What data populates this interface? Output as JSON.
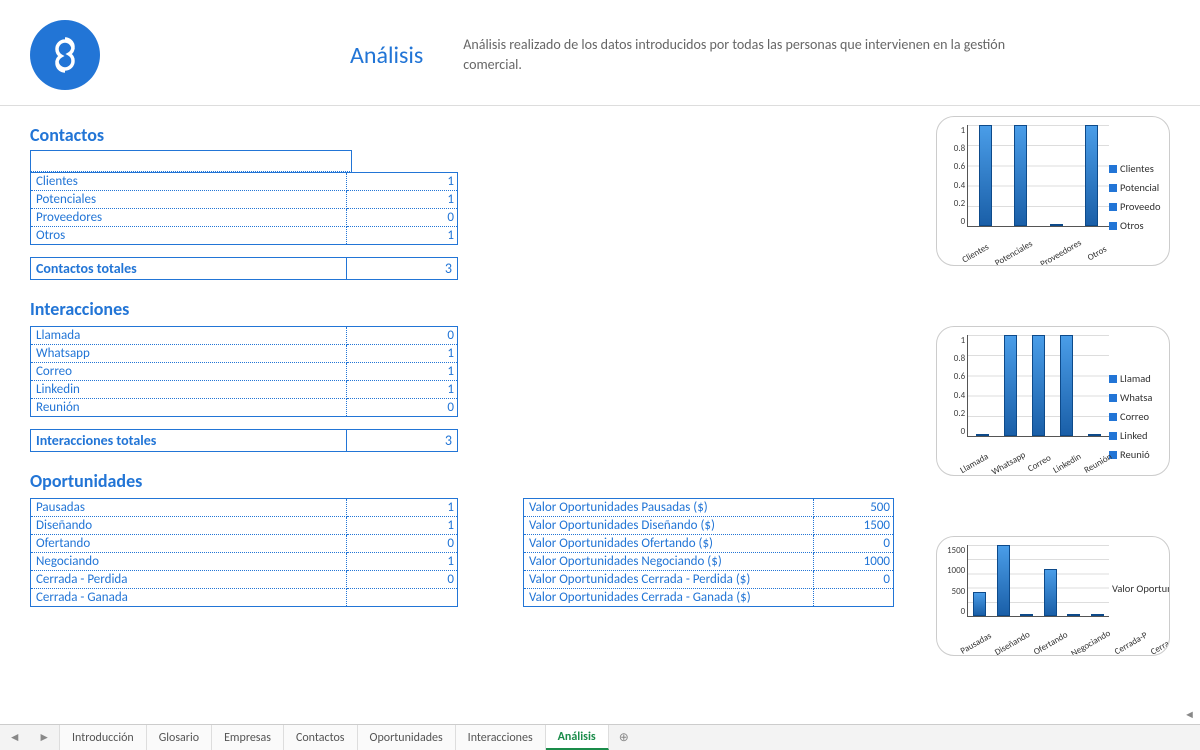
{
  "header": {
    "title": "Análisis",
    "subtitle": "Análisis realizado de los datos introducidos por todas las personas que intervienen en la gestión comercial."
  },
  "sections": {
    "contactos": {
      "title": "Contactos",
      "rows": [
        {
          "label": "Clientes",
          "value": 1
        },
        {
          "label": "Potenciales",
          "value": 1
        },
        {
          "label": "Proveedores",
          "value": 0
        },
        {
          "label": "Otros",
          "value": 1
        }
      ],
      "total_label": "Contactos totales",
      "total_value": 3
    },
    "interacciones": {
      "title": "Interacciones",
      "rows": [
        {
          "label": "Llamada",
          "value": 0
        },
        {
          "label": "Whatsapp",
          "value": 1
        },
        {
          "label": "Correo",
          "value": 1
        },
        {
          "label": "Linkedin",
          "value": 1
        },
        {
          "label": "Reunión",
          "value": 0
        }
      ],
      "total_label": "Interacciones totales",
      "total_value": 3
    },
    "oportunidades": {
      "title": "Oportunidades",
      "rows": [
        {
          "label": "Pausadas",
          "value": 1
        },
        {
          "label": "Diseñando",
          "value": 1
        },
        {
          "label": "Ofertando",
          "value": 0
        },
        {
          "label": "Negociando",
          "value": 1
        },
        {
          "label": "Cerrada - Perdida",
          "value": 0
        },
        {
          "label": "Cerrada - Ganada",
          "value": ""
        }
      ],
      "valor_rows": [
        {
          "label": "Valor Oportunidades Pausadas ($)",
          "value": 500
        },
        {
          "label": "Valor Oportunidades Diseñando ($)",
          "value": 1500
        },
        {
          "label": "Valor Oportunidades Ofertando ($)",
          "value": 0
        },
        {
          "label": "Valor Oportunidades Negociando ($)",
          "value": 1000
        },
        {
          "label": "Valor Oportunidades Cerrada - Perdida ($)",
          "value": 0
        },
        {
          "label": "Valor Oportunidades Cerrada - Ganada ($)",
          "value": ""
        }
      ]
    }
  },
  "chart_data": [
    {
      "type": "bar",
      "categories": [
        "Clientes",
        "Potenciales",
        "Proveedores",
        "Otros"
      ],
      "values": [
        1,
        1,
        0,
        1
      ],
      "ylim": [
        0,
        1
      ],
      "yticks": [
        "0",
        "0.2",
        "0.4",
        "0.6",
        "0.8",
        "1"
      ],
      "legend": [
        "Clientes",
        "Potencial",
        "Proveedo",
        "Otros"
      ]
    },
    {
      "type": "bar",
      "categories": [
        "Llamada",
        "Whatsapp",
        "Correo",
        "Linkedin",
        "Reunión"
      ],
      "values": [
        0,
        1,
        1,
        1,
        0
      ],
      "ylim": [
        0,
        1
      ],
      "yticks": [
        "0",
        "0.2",
        "0.4",
        "0.6",
        "0.8",
        "1"
      ],
      "legend": [
        "Llamad",
        "Whatsa",
        "Correo",
        "Linked",
        "Reunió"
      ]
    },
    {
      "type": "bar",
      "categories": [
        "Pausadas",
        "Diseñando",
        "Ofertando",
        "Negociando",
        "Cerrada-P",
        "Cerrada-G"
      ],
      "values": [
        500,
        1500,
        0,
        1000,
        0,
        0
      ],
      "ylim": [
        0,
        1500
      ],
      "yticks": [
        "0",
        "500",
        "1000",
        "1500"
      ],
      "legend": [
        "Valor Oportunida Pausadas"
      ]
    }
  ],
  "tabs": [
    "Introducción",
    "Glosario",
    "Empresas",
    "Contactos",
    "Oportunidades",
    "Interacciones",
    "Análisis"
  ],
  "active_tab": "Análisis"
}
